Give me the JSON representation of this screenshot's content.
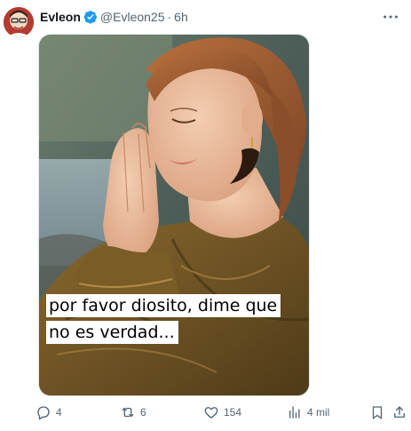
{
  "post": {
    "display_name": "Evleon",
    "handle": "@Evleon25",
    "separator": "·",
    "time": "6h",
    "media_caption": {
      "line1": "por favor diosito, dime que",
      "line2": "no es verdad..."
    }
  },
  "actions": {
    "replies": "4",
    "reposts": "6",
    "likes": "154",
    "views": "4 mil"
  },
  "colors": {
    "verified_badge": "#1d9bf0",
    "secondary_text": "#536471",
    "primary_text": "#0f1419"
  },
  "icons": {
    "reply": "reply-icon",
    "repost": "repost-icon",
    "like": "heart-icon",
    "views": "views-chart-icon",
    "bookmark": "bookmark-icon",
    "share": "share-icon",
    "more": "more-options-icon",
    "verified": "verified-badge-icon"
  }
}
